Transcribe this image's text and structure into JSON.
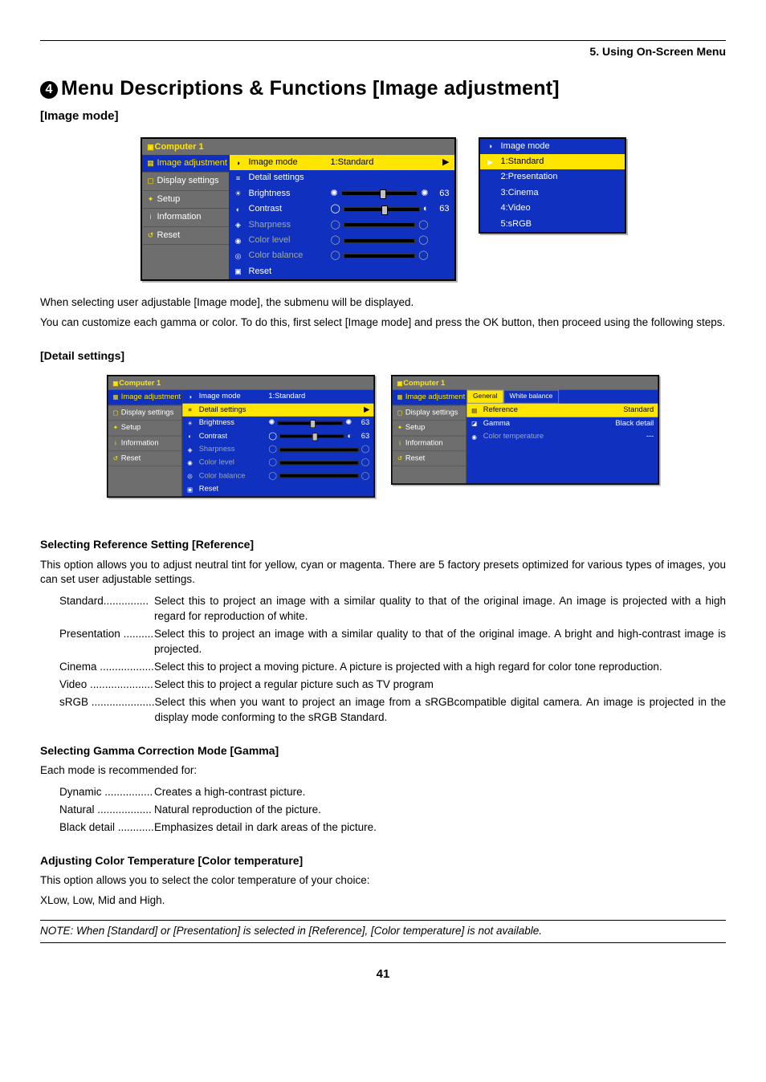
{
  "header": {
    "section": "5. Using On-Screen Menu"
  },
  "h1": "Menu Descriptions & Functions [Image adjustment]",
  "h1num": "4",
  "h2": "[Image mode]",
  "osd_title": "Computer 1",
  "sidebar": {
    "image_adjustment": "Image adjustment",
    "display_settings": "Display settings",
    "setup": "Setup",
    "information": "Information",
    "reset": "Reset"
  },
  "body_items": {
    "image_mode": "Image mode",
    "image_mode_val": "1:Standard",
    "detail_settings": "Detail settings",
    "brightness": "Brightness",
    "brightness_val": "63",
    "contrast": "Contrast",
    "contrast_val": "63",
    "sharpness": "Sharpness",
    "color_level": "Color level",
    "color_balance": "Color balance",
    "reset": "Reset"
  },
  "dropdown": {
    "header": "Image mode",
    "opt1": "1:Standard",
    "opt2": "2:Presentation",
    "opt3": "3:Cinema",
    "opt4": "4:Video",
    "opt5": "5:sRGB"
  },
  "intro_p1": "When selecting user adjustable [Image mode], the submenu will be displayed.",
  "intro_p2": "You can customize each gamma or color. To do this, first select [Image mode] and press the OK button, then proceed using the following steps.",
  "h3_detail": "[Detail settings]",
  "detail_right": {
    "tabs": {
      "general": "General",
      "white_balance": "White balance"
    },
    "reference": "Reference",
    "reference_val": "Standard",
    "gamma": "Gamma",
    "gamma_val": "Black detail",
    "color_temp": "Color temperature",
    "color_temp_val": "---"
  },
  "ref": {
    "heading": "Selecting Reference Setting [Reference]",
    "intro": "This option allows you to adjust neutral tint for yellow, cyan or magenta. There are 5 factory presets optimized for various types of images, you can set user adjustable settings.",
    "items": {
      "standard": {
        "term": "Standard",
        "desc": "Select this to project an image with a similar quality to that of the original image. An image is projected with a high regard for reproduction of white."
      },
      "presentation": {
        "term": "Presentation",
        "desc": "Select this to project an image with a similar quality to that of the original image. A bright and high-contrast image is projected."
      },
      "cinema": {
        "term": "Cinema",
        "desc": "Select this to project a moving picture. A picture is projected with a high regard for color tone reproduction."
      },
      "video": {
        "term": "Video",
        "desc": "Select this to project a regular picture such as TV program"
      },
      "srgb": {
        "term": "sRGB",
        "desc": "Select this when you want to project an image from a sRGBcompatible digital camera. An image is projected in the display mode conforming to the sRGB Standard."
      }
    }
  },
  "gamma": {
    "heading": "Selecting Gamma Correction Mode [Gamma]",
    "intro": "Each mode is recommended for:",
    "items": {
      "dynamic": {
        "term": "Dynamic",
        "desc": "Creates a high-contrast picture."
      },
      "natural": {
        "term": "Natural",
        "desc": "Natural reproduction of the picture."
      },
      "black": {
        "term": "Black detail",
        "desc": "Emphasizes detail in dark areas of the picture."
      }
    }
  },
  "ct": {
    "heading": "Adjusting Color Temperature [Color temperature]",
    "p1": "This option allows you to select the color temperature of your choice:",
    "p2": "XLow, Low, Mid and High."
  },
  "note": "NOTE: When [Standard] or [Presentation] is selected in [Reference], [Color temperature] is not available.",
  "pagenum": "41"
}
